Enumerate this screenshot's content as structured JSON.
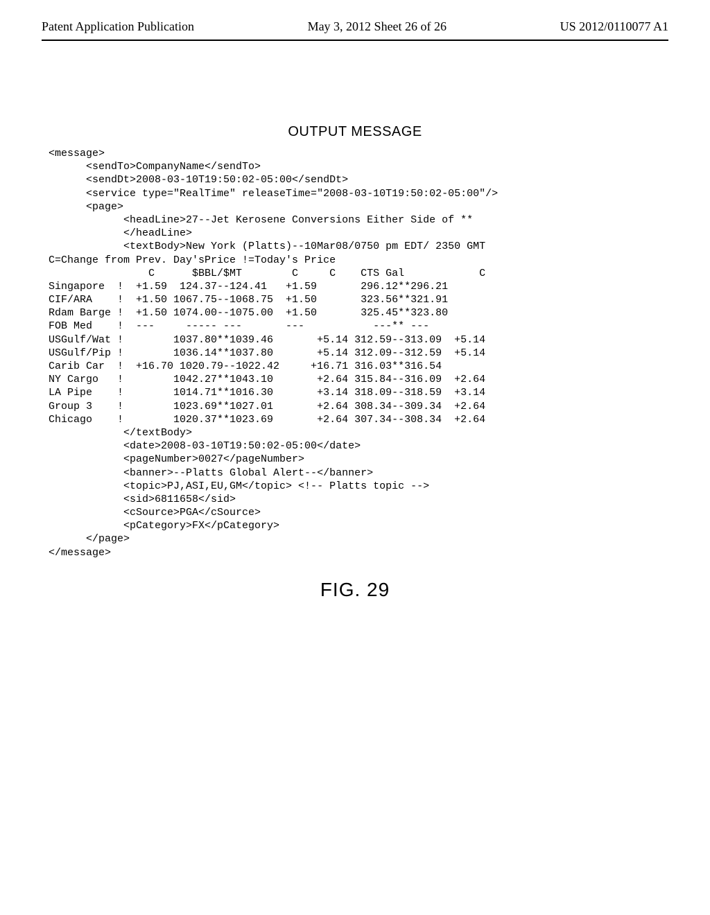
{
  "header": {
    "left": "Patent Application Publication",
    "center": "May 3, 2012  Sheet 26 of 26",
    "right": "US 2012/0110077 A1"
  },
  "title": "OUTPUT MESSAGE",
  "code": "<message>\n      <sendTo>CompanyName</sendTo>\n      <sendDt>2008-03-10T19:50:02-05:00</sendDt>\n      <service type=\"RealTime\" releaseTime=\"2008-03-10T19:50:02-05:00\"/>\n      <page>\n            <headLine>27--Jet Kerosene Conversions Either Side of **\n            </headLine>\n            <textBody>New York (Platts)--10Mar08/0750 pm EDT/ 2350 GMT\nC=Change from Prev. Day'sPrice !=Today's Price\n                C      $BBL/$MT        C     C    CTS Gal            C\nSingapore  !  +1.59  124.37--124.41   +1.59       296.12**296.21\nCIF/ARA    !  +1.50 1067.75--1068.75  +1.50       323.56**321.91\nRdam Barge !  +1.50 1074.00--1075.00  +1.50       325.45**323.80\nFOB Med    !  ---     ----- ---       ---           ---** ---\nUSGulf/Wat !        1037.80**1039.46       +5.14 312.59--313.09  +5.14\nUSGulf/Pip !        1036.14**1037.80       +5.14 312.09--312.59  +5.14\nCarib Car  !  +16.70 1020.79--1022.42     +16.71 316.03**316.54\nNY Cargo   !        1042.27**1043.10       +2.64 315.84--316.09  +2.64\nLA Pipe    !        1014.71**1016.30       +3.14 318.09--318.59  +3.14\nGroup 3    !        1023.69**1027.01       +2.64 308.34--309.34  +2.64\nChicago    !        1020.37**1023.69       +2.64 307.34--308.34  +2.64\n            </textBody>\n            <date>2008-03-10T19:50:02-05:00</date>\n            <pageNumber>0027</pageNumber>\n            <banner>--Platts Global Alert--</banner>\n            <topic>PJ,ASI,EU,GM</topic> <!-- Platts topic -->\n            <sid>6811658</sid>\n            <cSource>PGA</cSource>\n            <pCategory>FX</pCategory>\n      </page>\n</message>",
  "figure_label": "FIG. 29"
}
